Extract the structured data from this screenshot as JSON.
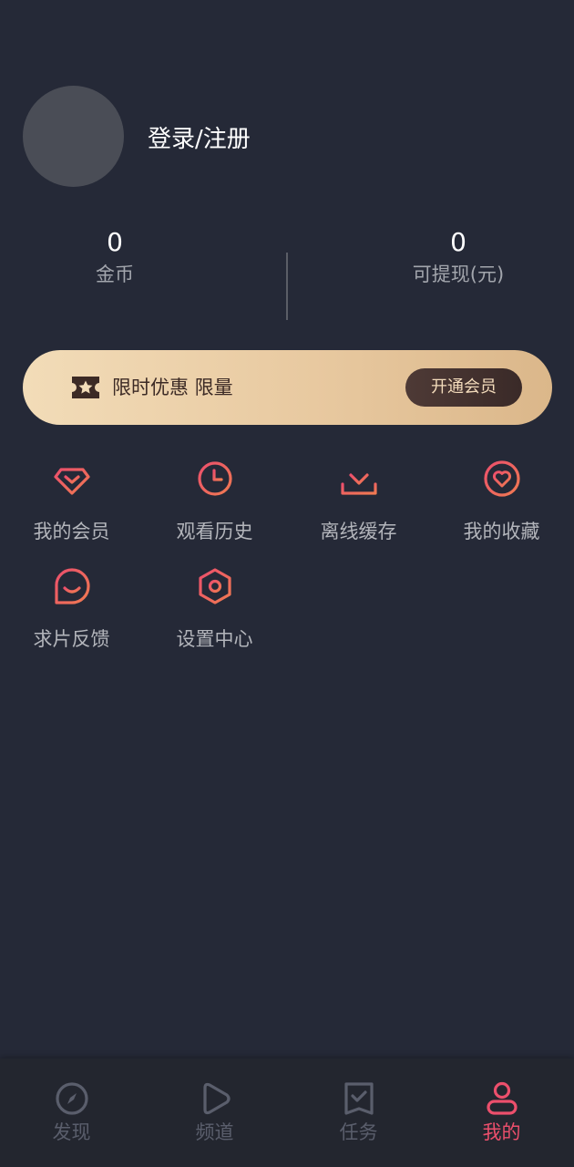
{
  "profile": {
    "login_label": "登录/注册"
  },
  "stats": {
    "coins": {
      "value": "0",
      "label": "金币"
    },
    "cash": {
      "value": "0",
      "label": "可提现(元)"
    }
  },
  "vip_banner": {
    "text": "限时优惠 限量",
    "button_label": "开通会员",
    "icon": "ticket-star-icon"
  },
  "menu": {
    "items": [
      {
        "label": "我的会员",
        "icon": "diamond-icon"
      },
      {
        "label": "观看历史",
        "icon": "clock-icon"
      },
      {
        "label": "离线缓存",
        "icon": "download-icon"
      },
      {
        "label": "我的收藏",
        "icon": "heart-icon"
      },
      {
        "label": "求片反馈",
        "icon": "chat-bubble-icon"
      },
      {
        "label": "设置中心",
        "icon": "settings-hexagon-icon"
      }
    ]
  },
  "bottom_nav": {
    "items": [
      {
        "label": "发现",
        "icon": "compass-icon",
        "active": false
      },
      {
        "label": "频道",
        "icon": "play-icon",
        "active": false
      },
      {
        "label": "任务",
        "icon": "task-icon",
        "active": false
      },
      {
        "label": "我的",
        "icon": "user-icon",
        "active": true
      }
    ]
  },
  "colors": {
    "background": "#252937",
    "accent": "#ec4f6c",
    "accent_gradient_start": "#ec4f6c",
    "accent_gradient_end": "#f07a52",
    "vip_gold": "#e8c9a0",
    "inactive_nav": "#5a5e6c"
  }
}
